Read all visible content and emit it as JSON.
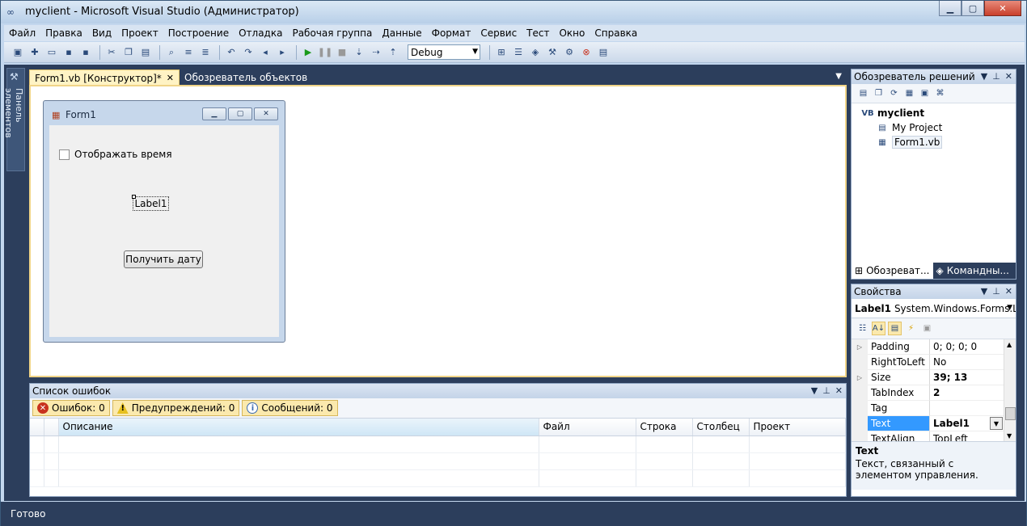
{
  "window": {
    "title": "myclient - Microsoft Visual Studio (Администратор)",
    "min": "▁",
    "max": "▢",
    "close": "✕"
  },
  "menu": [
    "Файл",
    "Правка",
    "Вид",
    "Проект",
    "Построение",
    "Отладка",
    "Рабочая группа",
    "Данные",
    "Формат",
    "Сервис",
    "Тест",
    "Окно",
    "Справка"
  ],
  "toolbar": {
    "config": "Debug"
  },
  "toolbox": {
    "label": "Панель элементов"
  },
  "doc_tabs": [
    {
      "label": "Form1.vb [Конструктор]*",
      "active": true
    },
    {
      "label": "Обозреватель объектов",
      "active": false
    }
  ],
  "form1": {
    "title": "Form1",
    "checkbox_label": "Отображать время",
    "label": "Label1",
    "button": "Получить дату"
  },
  "error_list": {
    "title": "Список ошибок",
    "errors": "Ошибок: 0",
    "warnings": "Предупреждений: 0",
    "messages": "Сообщений: 0",
    "columns": [
      "Описание",
      "Файл",
      "Строка",
      "Столбец",
      "Проект"
    ]
  },
  "solution_explorer": {
    "title": "Обозреватель решений",
    "items": [
      "myclient",
      "My Project",
      "Form1.vb"
    ],
    "tabs": [
      "Обозреват...",
      "Командны..."
    ]
  },
  "properties": {
    "title": "Свойства",
    "object_name": "Label1",
    "object_type": "System.Windows.Forms.La",
    "rows": [
      {
        "name": "Padding",
        "value": "0; 0; 0; 0"
      },
      {
        "name": "RightToLeft",
        "value": "No"
      },
      {
        "name": "Size",
        "value": "39; 13"
      },
      {
        "name": "TabIndex",
        "value": "2"
      },
      {
        "name": "Tag",
        "value": ""
      },
      {
        "name": "Text",
        "value": "Label1"
      },
      {
        "name": "TextAlign",
        "value": "TopLeft"
      }
    ],
    "desc_title": "Text",
    "desc_text": "Текст, связанный с элементом управления."
  },
  "status": "Готово"
}
